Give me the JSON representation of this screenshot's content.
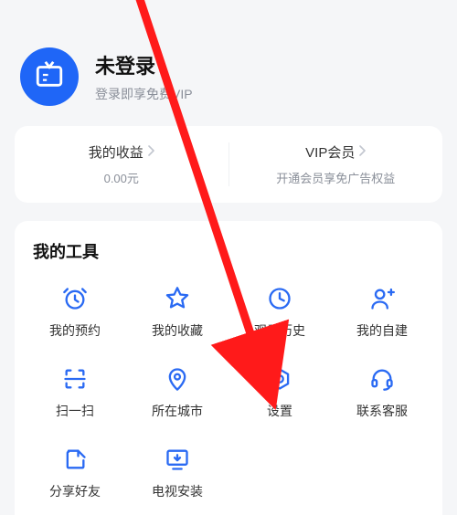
{
  "profile": {
    "title": "未登录",
    "subtitle": "登录即享免费VIP"
  },
  "benefits": {
    "earnings": {
      "label": "我的收益",
      "value": "0.00元"
    },
    "vip": {
      "label": "VIP会员",
      "subtitle": "开通会员享免广告权益"
    }
  },
  "tools": {
    "title": "我的工具",
    "items": [
      {
        "label": "我的预约"
      },
      {
        "label": "我的收藏"
      },
      {
        "label": "观看历史"
      },
      {
        "label": "我的自建"
      },
      {
        "label": "扫一扫"
      },
      {
        "label": "所在城市"
      },
      {
        "label": "设置"
      },
      {
        "label": "联系客服"
      },
      {
        "label": "分享好友"
      },
      {
        "label": "电视安装"
      }
    ]
  }
}
